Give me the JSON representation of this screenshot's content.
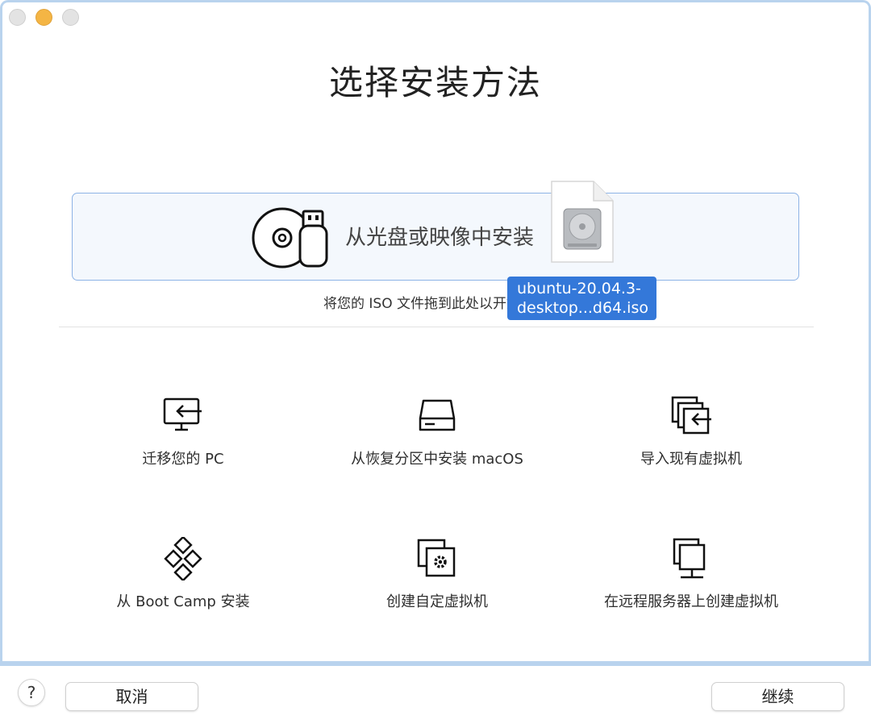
{
  "window": {
    "title": "选择安装方法"
  },
  "drop_zone": {
    "label": "从光盘或映像中安装",
    "hint": "将您的 ISO 文件拖到此处以开始安装"
  },
  "dragged_file": {
    "name_line1": "ubuntu-20.04.3-",
    "name_line2": "desktop...d64.iso"
  },
  "options": [
    {
      "label": "迁移您的 PC",
      "icon": "migrate-pc-icon"
    },
    {
      "label": "从恢复分区中安装 macOS",
      "icon": "recovery-disk-icon"
    },
    {
      "label": "导入现有虚拟机",
      "icon": "import-vm-icon"
    },
    {
      "label": "从 Boot Camp 安装",
      "icon": "bootcamp-icon"
    },
    {
      "label": "创建自定虚拟机",
      "icon": "custom-vm-icon"
    },
    {
      "label": "在远程服务器上创建虚拟机",
      "icon": "remote-server-icon"
    }
  ],
  "footer": {
    "help_label": "?",
    "cancel_label": "取消",
    "continue_label": "继续"
  },
  "colors": {
    "accent": "#3478d9",
    "drop_zone_bg": "#f4f8fd",
    "drop_zone_border": "#8db3e6",
    "minimize": "#f4b544"
  }
}
